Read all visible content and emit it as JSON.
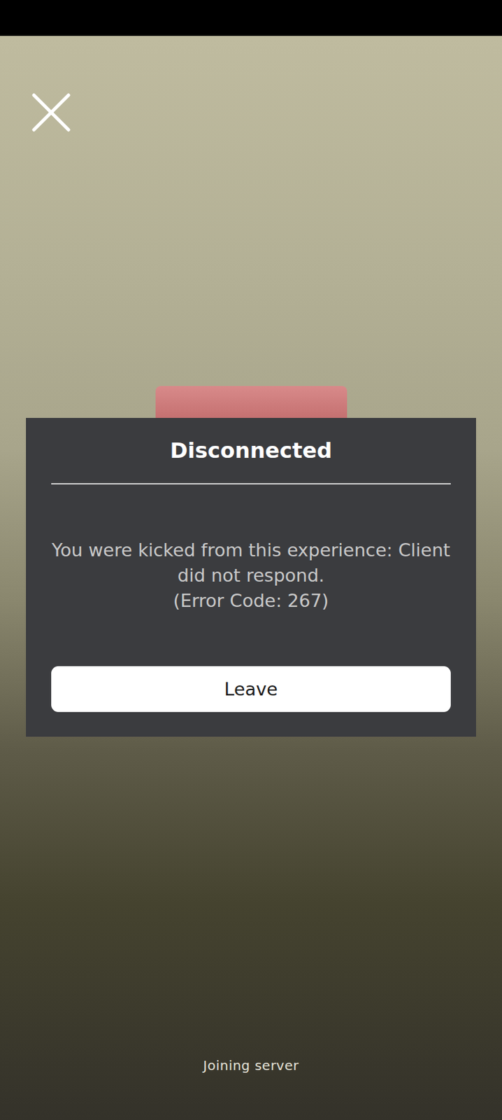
{
  "dialog": {
    "title": "Disconnected",
    "message": "You were kicked from this experience: Client did not respond.",
    "error_code": "(Error Code: 267)",
    "buttons": [
      "Leave"
    ]
  },
  "status": "Joining server"
}
